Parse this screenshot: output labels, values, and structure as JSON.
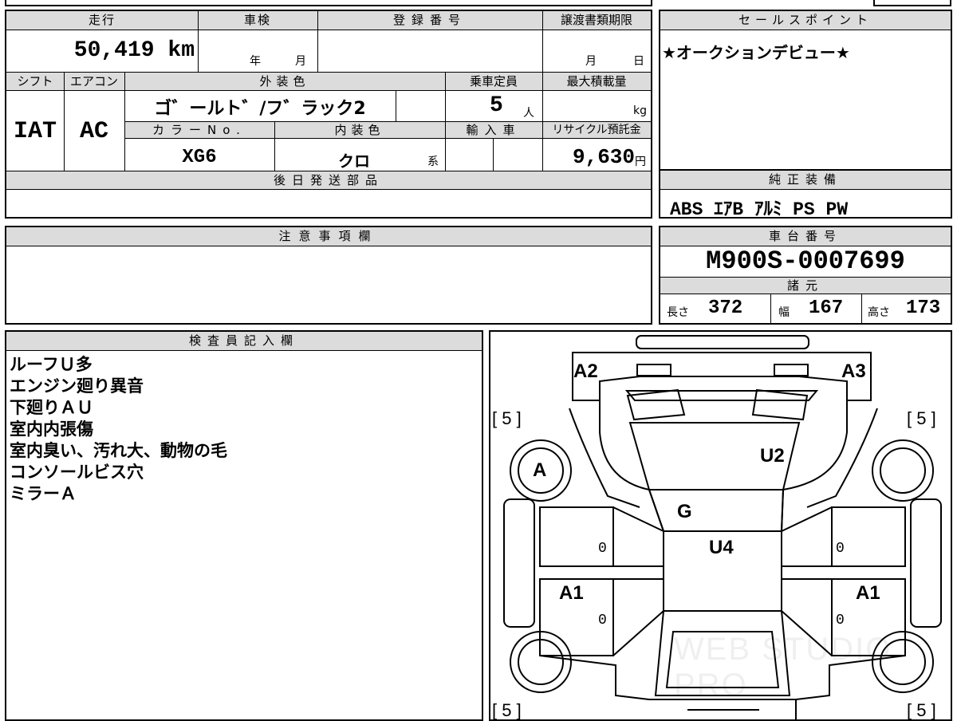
{
  "top_table": {
    "mileage_label": "走行",
    "mileage_value": "50,419 km",
    "inspection_label": "車検",
    "inspection_year": "年",
    "inspection_month": "月",
    "registration_label": "登録番号",
    "registration_value": "",
    "transfer_deadline_label": "譲渡書類期限",
    "transfer_month": "月",
    "transfer_day": "日",
    "shift_label": "シフト",
    "shift_value": "IAT",
    "aircon_label": "エアコン",
    "aircon_value": "AC",
    "exterior_label": "外装色",
    "exterior_value": "ゴ゛ールト゛/フ゛ラック2",
    "capacity_label": "乗車定員",
    "capacity_value": "5",
    "capacity_unit": "人",
    "max_load_label": "最大積載量",
    "max_load_unit": "kg",
    "color_no_label": "カラーNo.",
    "color_no_value": "XG6",
    "interior_label": "内装色",
    "interior_value": "クロ",
    "interior_suffix": "系",
    "import_label": "輸入車",
    "recycle_label": "リサイクル預託金",
    "recycle_value": "9,630",
    "recycle_unit": "円",
    "later_parts_label": "後日発送部品",
    "later_parts_value": ""
  },
  "sales_point": {
    "label": "セールスポイント",
    "text": "★オークションデビュー★"
  },
  "equipment": {
    "label": "純正装備",
    "items": "ABS ｴｱB ｱﾙﾐ PS PW"
  },
  "caution": {
    "label": "注意事項欄",
    "text": ""
  },
  "chassis": {
    "label": "車台番号",
    "value": "M900S-0007699",
    "specs_label": "諸元",
    "length_label": "長さ",
    "length_value": "372",
    "width_label": "幅",
    "width_value": "167",
    "height_label": "高さ",
    "height_value": "173"
  },
  "inspector": {
    "label": "検査員記入欄",
    "lines": [
      "ルーフＵ多",
      "エンジン廻り異音",
      "下廻りＡＵ",
      "室内内張傷",
      "室内臭い、汚れ大、動物の毛",
      "コンソールビス穴",
      "ミラーＡ"
    ]
  },
  "diagram": {
    "watermark": "WEB STUDIO PRO",
    "tire_fl": "[ 5 ]",
    "tire_fr": "[ 5 ]",
    "tire_rl": "[ 5 ]",
    "tire_rr": "[ 5 ]",
    "a2": "A2",
    "a3": "A3",
    "wheel_a": "A",
    "roof_u2": "U2",
    "glass_g": "G",
    "roof_u4": "U4",
    "left_a1": "A1",
    "right_a1": "A1",
    "zero": "0"
  }
}
